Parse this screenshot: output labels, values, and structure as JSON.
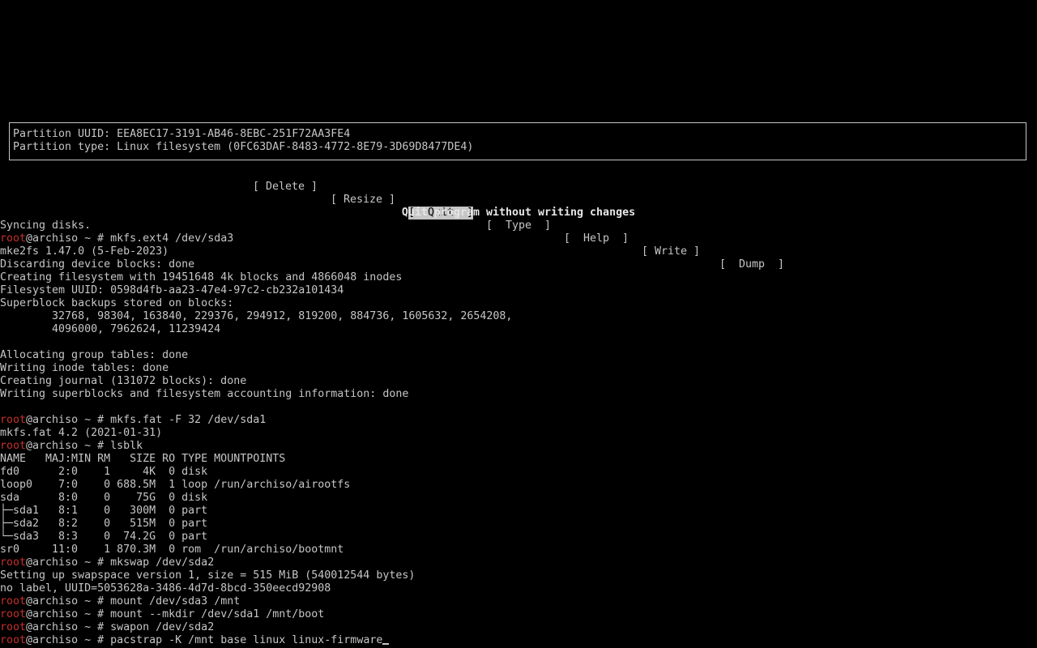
{
  "partition_info": {
    "uuid_line": "Partition UUID: EEA8EC17-3191-AB46-8EBC-251F72AA3FE4",
    "type_line": "Partition type: Linux filesystem (0FC63DAF-8483-4772-8E79-3D69D8477DE4)"
  },
  "menu": {
    "items": [
      {
        "label": "[ Delete ]",
        "selected": false
      },
      {
        "label": "[ Resize ]",
        "selected": false
      },
      {
        "label": "[  Quit  ]",
        "selected": true
      },
      {
        "label": "[  Type  ]",
        "selected": false
      },
      {
        "label": "[  Help  ]",
        "selected": false
      },
      {
        "label": "[ Write ]",
        "selected": false
      },
      {
        "label": "[  Dump  ]",
        "selected": false
      }
    ],
    "hint": "Quit program without writing changes"
  },
  "terminal": {
    "prompt_user": "root",
    "prompt_rest": "@archiso ~ # ",
    "lines": [
      {
        "text": "Syncing disks."
      },
      {
        "cmd": "mkfs.ext4 /dev/sda3"
      },
      {
        "text": "mke2fs 1.47.0 (5-Feb-2023)"
      },
      {
        "text": "Discarding device blocks: done"
      },
      {
        "text": "Creating filesystem with 19451648 4k blocks and 4866048 inodes"
      },
      {
        "text": "Filesystem UUID: 0598d4fb-aa23-47e4-97c2-cb232a101434"
      },
      {
        "text": "Superblock backups stored on blocks:"
      },
      {
        "text": "        32768, 98304, 163840, 229376, 294912, 819200, 884736, 1605632, 2654208,"
      },
      {
        "text": "        4096000, 7962624, 11239424"
      },
      {
        "text": ""
      },
      {
        "text": "Allocating group tables: done"
      },
      {
        "text": "Writing inode tables: done"
      },
      {
        "text": "Creating journal (131072 blocks): done"
      },
      {
        "text": "Writing superblocks and filesystem accounting information: done"
      },
      {
        "text": ""
      },
      {
        "cmd": "mkfs.fat -F 32 /dev/sda1"
      },
      {
        "text": "mkfs.fat 4.2 (2021-01-31)"
      },
      {
        "cmd": "lsblk"
      },
      {
        "text": "NAME   MAJ:MIN RM   SIZE RO TYPE MOUNTPOINTS"
      },
      {
        "text": "fd0      2:0    1     4K  0 disk"
      },
      {
        "text": "loop0    7:0    0 688.5M  1 loop /run/archiso/airootfs"
      },
      {
        "text": "sda      8:0    0    75G  0 disk"
      },
      {
        "text": "├─sda1   8:1    0   300M  0 part"
      },
      {
        "text": "├─sda2   8:2    0   515M  0 part"
      },
      {
        "text": "└─sda3   8:3    0  74.2G  0 part"
      },
      {
        "text": "sr0     11:0    1 870.3M  0 rom  /run/archiso/bootmnt"
      },
      {
        "cmd": "mkswap /dev/sda2"
      },
      {
        "text": "Setting up swapspace version 1, size = 515 MiB (540012544 bytes)"
      },
      {
        "text": "no label, UUID=5053628a-3486-4d7d-8bcd-350eecd92908"
      },
      {
        "cmd": "mount /dev/sda3 /mnt"
      },
      {
        "cmd": "mount --mkdir /dev/sda1 /mnt/boot"
      },
      {
        "cmd": "swapon /dev/sda2"
      },
      {
        "cmd": "pacstrap -K /mnt base linux linux-firmware",
        "cursor": true
      }
    ]
  },
  "colors": {
    "background": "#000000",
    "foreground": "#c6c6c6",
    "prompt_user": "#c4302b"
  }
}
